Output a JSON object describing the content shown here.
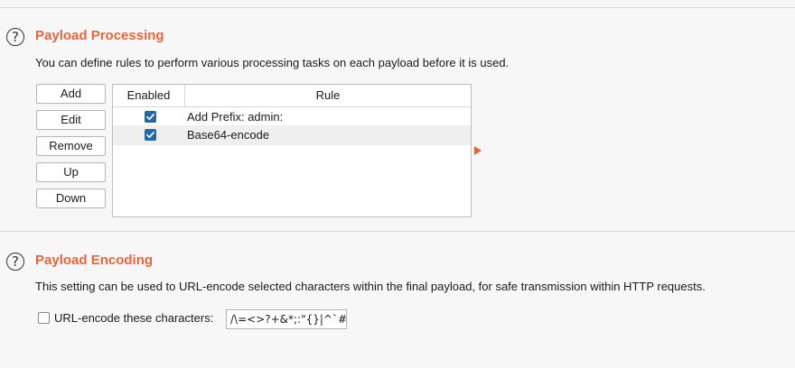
{
  "processing": {
    "help_icon": "question-circle-icon",
    "help_glyph": "?",
    "title": "Payload Processing",
    "description": "You can define rules to perform various processing tasks on each payload before it is used.",
    "buttons": {
      "add": "Add",
      "edit": "Edit",
      "remove": "Remove",
      "up": "Up",
      "down": "Down"
    },
    "table": {
      "columns": [
        "Enabled",
        "Rule"
      ],
      "rows": [
        {
          "enabled": true,
          "rule": "Add Prefix: admin:"
        },
        {
          "enabled": true,
          "rule": "Base64-encode"
        }
      ]
    }
  },
  "encoding": {
    "help_icon": "question-circle-icon",
    "help_glyph": "?",
    "title": "Payload Encoding",
    "description": "This setting can be used to URL-encode selected characters within the final payload, for safe transmission within HTTP requests.",
    "checkbox_label": "URL-encode these characters:",
    "checkbox_checked": false,
    "characters": "/\\=<>?+&*;:\"{}|^`#"
  },
  "colors": {
    "accent": "#e8643a",
    "checkbox": "#2468a8"
  }
}
